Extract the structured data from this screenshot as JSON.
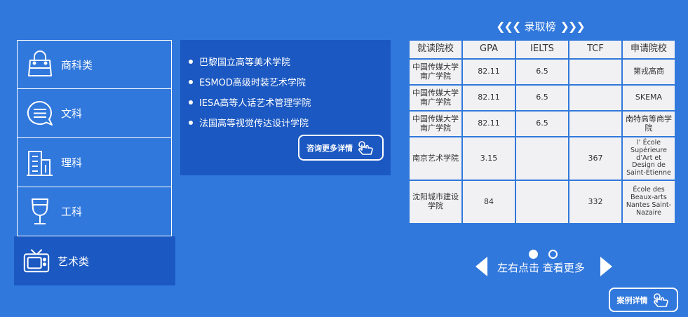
{
  "categories": [
    {
      "label": "商科类",
      "icon": "handbag-icon"
    },
    {
      "label": "文科",
      "icon": "chat-bubble-icon"
    },
    {
      "label": "理科",
      "icon": "building-icon"
    },
    {
      "label": "工科",
      "icon": "wine-glass-icon"
    },
    {
      "label": "艺术类",
      "icon": "tv-icon",
      "active": true
    }
  ],
  "schools": [
    "巴黎国立高等美术学院",
    "ESMOD高级时装艺术学院",
    "IESA高等人话艺术管理学院",
    "法国高等视觉传达设计学院"
  ],
  "consult_button": "咨询更多详情",
  "ranking": {
    "title": "录取榜",
    "headers": [
      "就读院校",
      "GPA",
      "IELTS",
      "TCF",
      "申请院校"
    ],
    "rows": [
      {
        "school": "中国传媒大学南广学院",
        "gpa": "82.11",
        "ielts": "6.5",
        "tcf": "",
        "target": "第戎高商"
      },
      {
        "school": "中国传媒大学南广学院",
        "gpa": "82.11",
        "ielts": "6.5",
        "tcf": "",
        "target": "SKEMA"
      },
      {
        "school": "中国传媒大学南广学院",
        "gpa": "82.11",
        "ielts": "6.5",
        "tcf": "",
        "target": "南特高等商学院"
      },
      {
        "school": "南京艺术学院",
        "gpa": "3.15",
        "ielts": "",
        "tcf": "367",
        "target": "l’ École Supérieure d’Art et Design de Saint-Etienne"
      },
      {
        "school": "沈阳城市建设学院",
        "gpa": "84",
        "ielts": "",
        "tcf": "332",
        "target": "École des Beaux-arts Nantes Saint-Nazaire"
      }
    ]
  },
  "pager": {
    "hint": "左右点击 查看更多",
    "current_page": 1,
    "total_pages": 2
  },
  "case_button": "案例详情",
  "colors": {
    "background": "#3178dc",
    "panel": "#1b58c2",
    "table_bg": "#f1f1f3"
  }
}
